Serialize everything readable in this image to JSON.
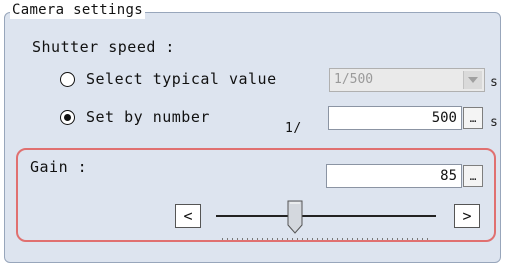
{
  "group_title": "Camera settings",
  "shutter": {
    "label": "Shutter speed :",
    "typical_option": "Select typical value",
    "typical_value": "1/500",
    "by_number_option": "Set by number",
    "selected_option": "by_number",
    "prefix": "1/",
    "number_value": "500",
    "unit": "s"
  },
  "gain": {
    "label": "Gain :",
    "value": "85",
    "slider_fraction": 0.36,
    "decrease_label": "<",
    "increase_label": ">"
  },
  "ellipsis": "…"
}
